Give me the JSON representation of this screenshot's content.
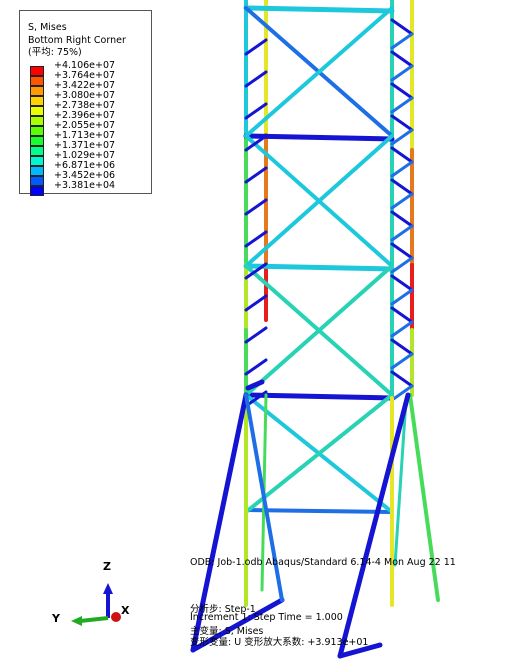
{
  "legend": {
    "title": "S, Mises",
    "subtitle": "Bottom Right Corner",
    "averaging": "(平均: 75%)",
    "entries": [
      {
        "value": "+4.106e+07",
        "color": "#ff0000"
      },
      {
        "value": "+3.764e+07",
        "color": "#ff5500"
      },
      {
        "value": "+3.422e+07",
        "color": "#ff9a00"
      },
      {
        "value": "+3.080e+07",
        "color": "#ffd200"
      },
      {
        "value": "+2.738e+07",
        "color": "#e8ff00"
      },
      {
        "value": "+2.396e+07",
        "color": "#a8ff00"
      },
      {
        "value": "+2.055e+07",
        "color": "#5cff00"
      },
      {
        "value": "+1.713e+07",
        "color": "#18ff2e"
      },
      {
        "value": "+1.371e+07",
        "color": "#00ff8a"
      },
      {
        "value": "+1.029e+07",
        "color": "#00f5d0"
      },
      {
        "value": "+6.871e+06",
        "color": "#00b8ff"
      },
      {
        "value": "+3.452e+06",
        "color": "#005aff"
      },
      {
        "value": "+3.381e+04",
        "color": "#0000ff"
      }
    ]
  },
  "info": {
    "odb_line": "ODB: Job-1.odb    Abaqus/Standard 6.14-4    Mon Aug 22 11",
    "step_line": "分析步: Step-1",
    "increment_line": "Increment     1: Step Time =    1.000",
    "primary_var_line": "主变量: S, Mises",
    "deformed_var_line": "变形变量: U   变形放大系数: +3.913e+01"
  },
  "triad": {
    "z": "Z",
    "y": "Y",
    "x": "X"
  },
  "colors": {
    "blue": "#1414d2",
    "mid_blue": "#1e6ee6",
    "cyan": "#1ec8dc",
    "teal": "#28d2b4",
    "green": "#46dc5a",
    "yellow_green": "#b4e628",
    "yellow": "#e6e628",
    "orange": "#e6781e",
    "red": "#e61e1e"
  }
}
